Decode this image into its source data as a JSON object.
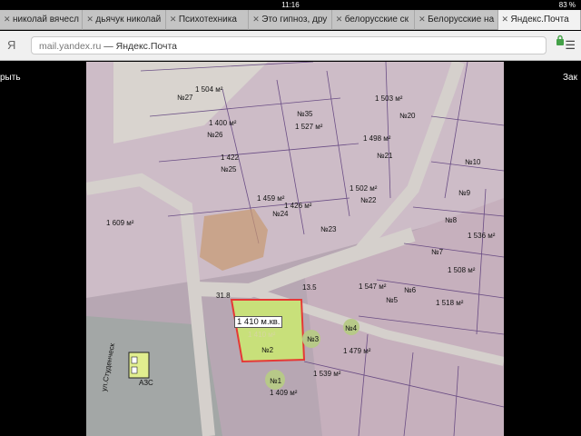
{
  "status": {
    "time": "11:16",
    "battery": "83 %"
  },
  "tabs": [
    {
      "label": "николай вячесл"
    },
    {
      "label": "дьячук николай"
    },
    {
      "label": "Психотехника"
    },
    {
      "label": "Это гипноз, дру"
    },
    {
      "label": "белорусские ск"
    },
    {
      "label": "Белорусские на"
    },
    {
      "label": "Яндекс.Почта"
    }
  ],
  "address": {
    "host": "mail.yandex.ru",
    "title": "Яндекс.Почта",
    "logo": "Я"
  },
  "side": {
    "left": "рыть",
    "right": "Зак"
  },
  "icons": {
    "lock": "lock-icon",
    "menu": "menu-icon",
    "close": "close-icon"
  },
  "colors": {
    "tab_active": "#f2f2f2",
    "tab_bar": "#c4c4c4",
    "parcel_red": "#e53935",
    "parcel_fill": "#c8e07a",
    "road": "#b8b8b8"
  },
  "map": {
    "labels": [
      {
        "id": "l1",
        "text": "1 504 м²"
      },
      {
        "id": "l2",
        "text": "№27"
      },
      {
        "id": "l3",
        "text": "1 400 м²"
      },
      {
        "id": "l4",
        "text": "№26"
      },
      {
        "id": "l5",
        "text": "№35"
      },
      {
        "id": "l6",
        "text": "1 527 м²"
      },
      {
        "id": "l7",
        "text": "1 503 м²"
      },
      {
        "id": "l8",
        "text": "№20"
      },
      {
        "id": "l9",
        "text": "1 498 м²"
      },
      {
        "id": "l10",
        "text": "№21"
      },
      {
        "id": "l11",
        "text": "1 422"
      },
      {
        "id": "l12",
        "text": "№25"
      },
      {
        "id": "l13",
        "text": "1 502 м²"
      },
      {
        "id": "l14",
        "text": "№22"
      },
      {
        "id": "l15",
        "text": "1 459 м²"
      },
      {
        "id": "l16",
        "text": "1 426 м²"
      },
      {
        "id": "l17",
        "text": "№24"
      },
      {
        "id": "l18",
        "text": "№23"
      },
      {
        "id": "l19",
        "text": "1 609 м²"
      },
      {
        "id": "l20",
        "text": "№10"
      },
      {
        "id": "l21",
        "text": "№9"
      },
      {
        "id": "l22",
        "text": "№8"
      },
      {
        "id": "l23",
        "text": "№7"
      },
      {
        "id": "l24",
        "text": "1 536 м²"
      },
      {
        "id": "l25",
        "text": "1 508 м²"
      },
      {
        "id": "l26",
        "text": "1 547 м²"
      },
      {
        "id": "l27",
        "text": "№6"
      },
      {
        "id": "l28",
        "text": "№5"
      },
      {
        "id": "l29",
        "text": "1 518 м²"
      },
      {
        "id": "l30",
        "text": "1 410 м.кв."
      },
      {
        "id": "l31",
        "text": "1 410 м²"
      },
      {
        "id": "l32",
        "text": "№2"
      },
      {
        "id": "l33",
        "text": "№3"
      },
      {
        "id": "l34",
        "text": "№4"
      },
      {
        "id": "l35",
        "text": "1 479 м²"
      },
      {
        "id": "l36",
        "text": "1 539 м²"
      },
      {
        "id": "l37",
        "text": "№1"
      },
      {
        "id": "l38",
        "text": "1 409 м²"
      },
      {
        "id": "l39",
        "text": "ул.Студенческ"
      },
      {
        "id": "l40",
        "text": "АЗС"
      },
      {
        "id": "l41",
        "text": "31.8"
      },
      {
        "id": "l42",
        "text": "13.5"
      }
    ]
  }
}
